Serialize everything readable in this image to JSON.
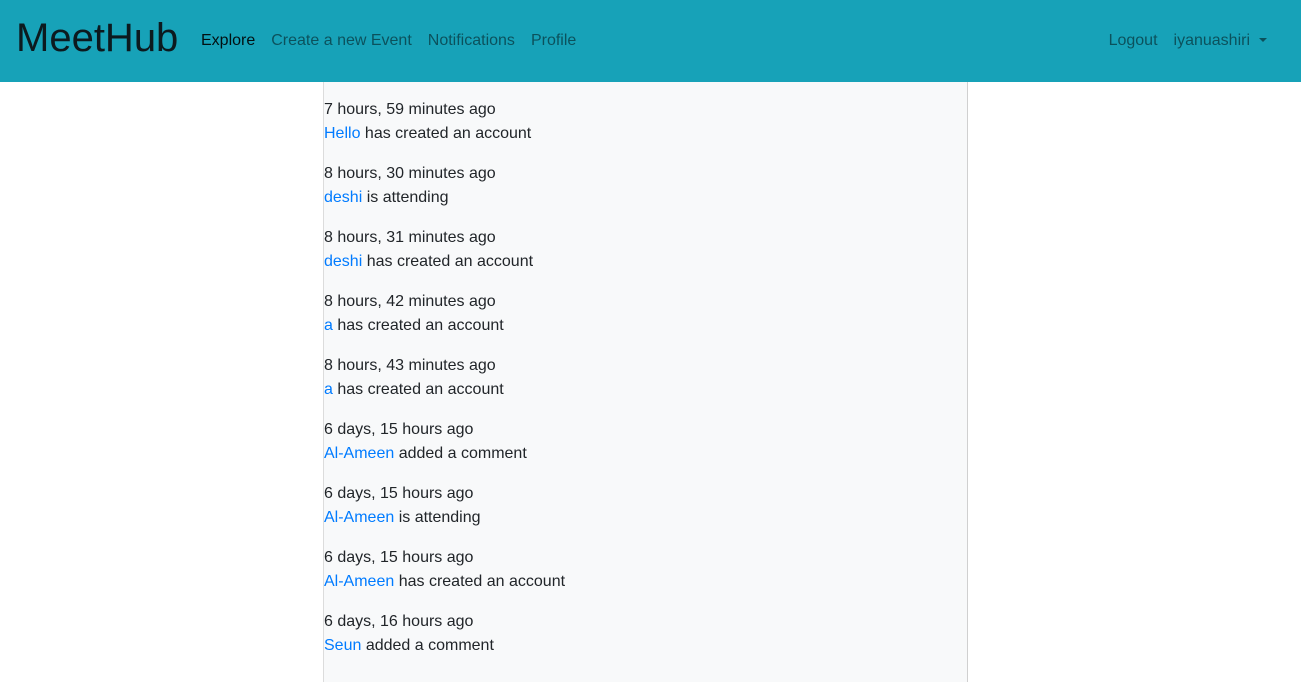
{
  "navbar": {
    "brand": "MeetHub",
    "links": [
      {
        "label": "Explore",
        "active": true
      },
      {
        "label": "Create a new Event",
        "active": false
      },
      {
        "label": "Notifications",
        "active": false
      },
      {
        "label": "Profile",
        "active": false
      }
    ],
    "logout": "Logout",
    "username": "iyanuashiri"
  },
  "feed": [
    {
      "time": "7 hours, 59 minutes ago",
      "user": "Hello",
      "action": " has created an account"
    },
    {
      "time": "8 hours, 30 minutes ago",
      "user": "deshi",
      "action": " is attending"
    },
    {
      "time": "8 hours, 31 minutes ago",
      "user": "deshi",
      "action": " has created an account"
    },
    {
      "time": "8 hours, 42 minutes ago",
      "user": "a",
      "action": " has created an account"
    },
    {
      "time": "8 hours, 43 minutes ago",
      "user": "a",
      "action": " has created an account"
    },
    {
      "time": "6 days, 15 hours ago",
      "user": "Al-Ameen",
      "action": " added a comment"
    },
    {
      "time": "6 days, 15 hours ago",
      "user": "Al-Ameen",
      "action": " is attending"
    },
    {
      "time": "6 days, 15 hours ago",
      "user": "Al-Ameen",
      "action": " has created an account"
    },
    {
      "time": "6 days, 16 hours ago",
      "user": "Seun",
      "action": " added a comment"
    }
  ]
}
